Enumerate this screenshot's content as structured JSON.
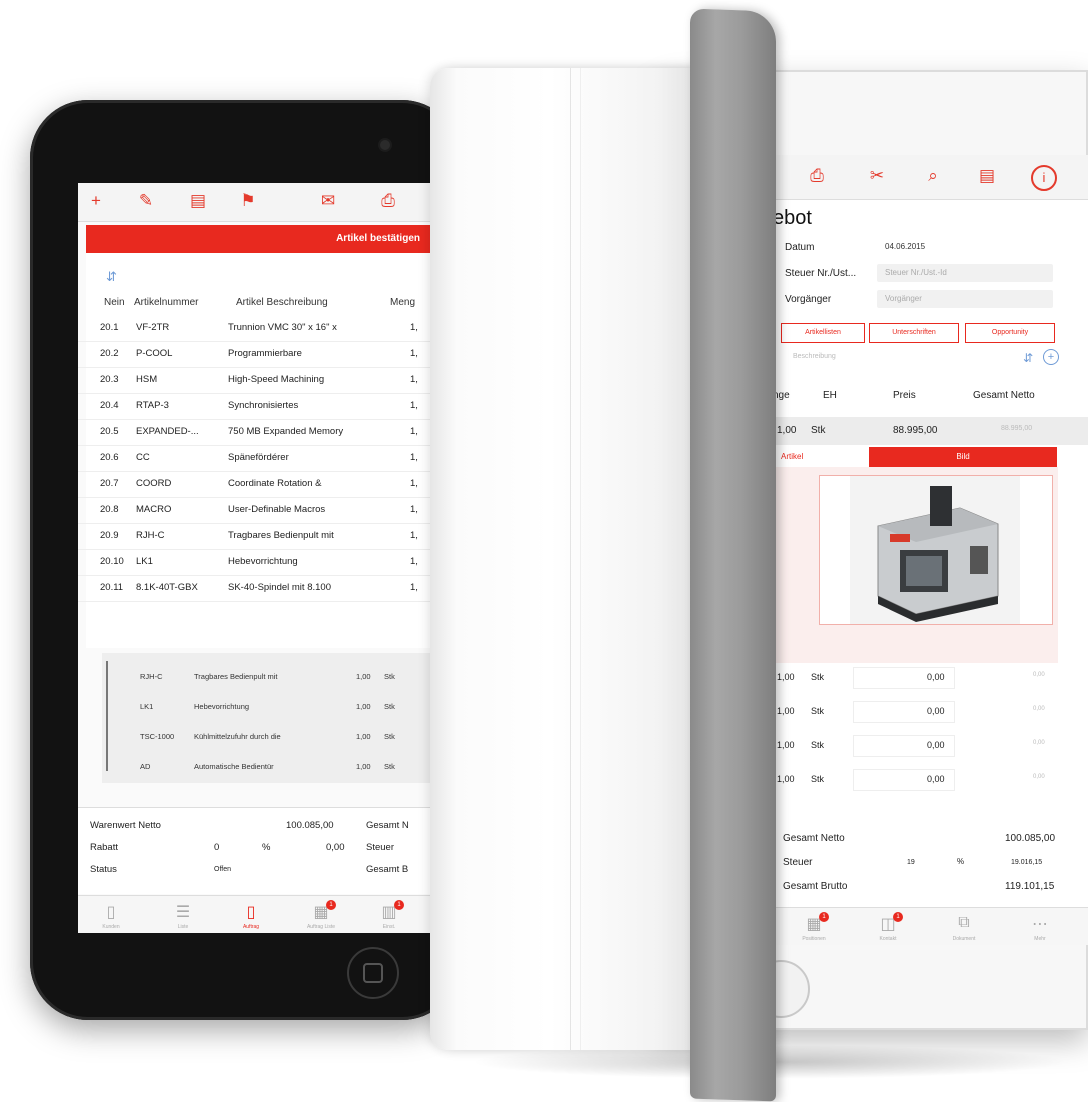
{
  "left_ipad": {
    "confirm_label": "Artikel bestätigen",
    "columns": [
      "Nein",
      "Artikelnummer",
      "Artikel Beschreibung",
      "Meng"
    ],
    "rows": [
      {
        "no": "20.1",
        "art": "VF-2TR",
        "desc": "Trunnion VMC 30\" x 16\" x",
        "qty": "1,"
      },
      {
        "no": "20.2",
        "art": "P-COOL",
        "desc": "Programmierbare",
        "qty": "1,"
      },
      {
        "no": "20.3",
        "art": "HSM",
        "desc": "High-Speed Machining",
        "qty": "1,"
      },
      {
        "no": "20.4",
        "art": "RTAP-3",
        "desc": "Synchronisiertes",
        "qty": "1,"
      },
      {
        "no": "20.5",
        "art": "EXPANDED-...",
        "desc": "750 MB Expanded Memory",
        "qty": "1,"
      },
      {
        "no": "20.6",
        "art": "CC",
        "desc": "Spänefördérer",
        "qty": "1,"
      },
      {
        "no": "20.7",
        "art": "COORD",
        "desc": "Coordinate Rotation &",
        "qty": "1,"
      },
      {
        "no": "20.8",
        "art": "MACRO",
        "desc": "User-Definable Macros",
        "qty": "1,"
      },
      {
        "no": "20.9",
        "art": "RJH-C",
        "desc": "Tragbares Bedienpult mit",
        "qty": "1,"
      },
      {
        "no": "20.10",
        "art": "LK1",
        "desc": "Hebevorrichtung",
        "qty": "1,"
      },
      {
        "no": "20.11",
        "art": "8.1K-40T-GBX",
        "desc": "SK-40-Spindel mit 8.100",
        "qty": "1,"
      }
    ],
    "sub_rows": [
      {
        "art": "RJH-C",
        "desc": "Tragbares Bedienpult mit",
        "qty": "1,00",
        "unit": "Stk"
      },
      {
        "art": "LK1",
        "desc": "Hebevorrichtung",
        "qty": "1,00",
        "unit": "Stk"
      },
      {
        "art": "TSC-1000",
        "desc": "Kühlmittelzufuhr durch die",
        "qty": "1,00",
        "unit": "Stk"
      },
      {
        "art": "AD",
        "desc": "Automatische Bedientür",
        "qty": "1,00",
        "unit": "Stk"
      }
    ],
    "summary": {
      "warenwert_label": "Warenwert Netto",
      "warenwert_value": "100.085,00",
      "gesamt_netto_label": "Gesamt N",
      "rabatt_label": "Rabatt",
      "rabatt_pct": "0",
      "pct_sign": "%",
      "rabatt_value": "0,00",
      "steuer_label": "Steuer",
      "status_label": "Status",
      "status_value": "Offen",
      "gesamt_brutto_label": "Gesamt B"
    },
    "tabs": [
      {
        "icon": "document-icon",
        "label": "Kunden"
      },
      {
        "icon": "list-icon",
        "label": "Liste"
      },
      {
        "icon": "page-icon",
        "label": "Auftrag",
        "active": true
      },
      {
        "icon": "inbox-icon",
        "label": "Auftrag Liste",
        "badge": "1"
      },
      {
        "icon": "stack-icon",
        "label": "Einst.",
        "badge": "1"
      }
    ]
  },
  "right_ipad": {
    "title": "ebot",
    "fields": [
      {
        "label": "Datum",
        "value": "04.06.2015"
      },
      {
        "label": "Steuer Nr./Ust...",
        "value": "Steuer Nr./Ust.-Id",
        "placeholder": true
      },
      {
        "label": "Vorgänger",
        "value": "Vorgänger",
        "placeholder": true
      }
    ],
    "segments": [
      "Artikellisten",
      "Unterschriften",
      "Opportunity"
    ],
    "search_placeholder": "Beschreibung",
    "columns": [
      "nge",
      "EH",
      "Preis",
      "Gesamt Netto"
    ],
    "item": {
      "qty": "1,00",
      "unit": "Stk",
      "price": "88.995,00",
      "total": "88.995,00"
    },
    "red_tab_left": "Artikel",
    "red_tab_right": "Bild",
    "sub_rows": [
      {
        "qty": "1,00",
        "unit": "Stk",
        "price": "0,00",
        "total": "0,00"
      },
      {
        "qty": "1,00",
        "unit": "Stk",
        "price": "0,00",
        "total": "0,00"
      },
      {
        "qty": "1,00",
        "unit": "Stk",
        "price": "0,00",
        "total": "0,00"
      },
      {
        "qty": "1,00",
        "unit": "Stk",
        "price": "0,00",
        "total": "0,00"
      }
    ],
    "totals": {
      "netto_label": "Gesamt Netto",
      "netto_value": "100.085,00",
      "steuer_label": "Steuer",
      "steuer_pct": "19",
      "pct_sign": "%",
      "steuer_value": "19.016,15",
      "brutto_label": "Gesamt Brutto",
      "brutto_value": "119.101,15"
    },
    "tabs": [
      {
        "icon": "inbox-icon",
        "label": "Positionen",
        "badge": "1"
      },
      {
        "icon": "person-icon",
        "label": "Kontakt",
        "badge": "1"
      },
      {
        "icon": "copy-icon",
        "label": "Dokument"
      },
      {
        "icon": "more-icon",
        "label": "Mehr"
      }
    ]
  },
  "colors": {
    "accent": "#e8291f",
    "link": "#6f9bd6"
  }
}
